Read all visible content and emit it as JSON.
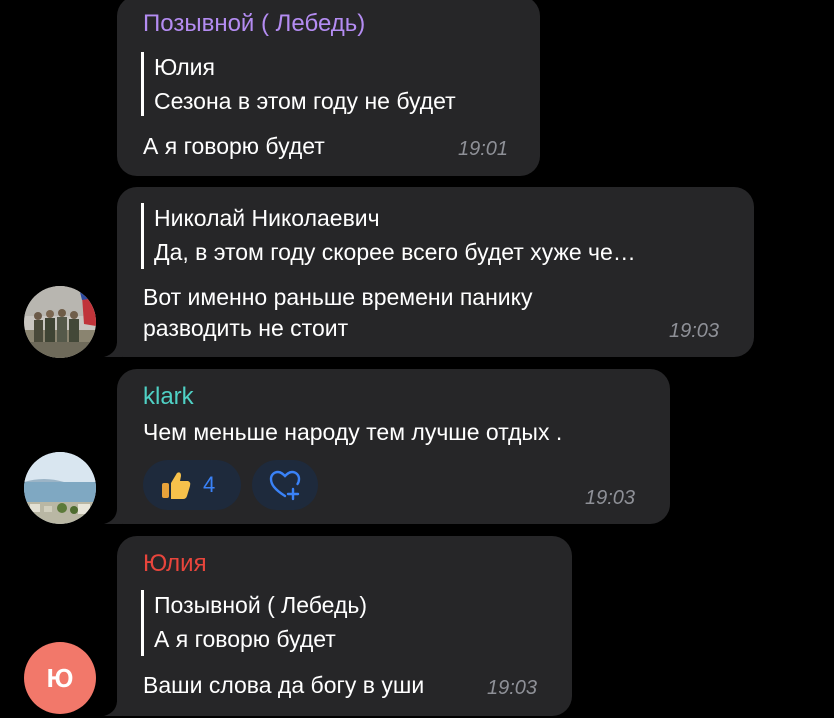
{
  "colors": {
    "background": "#000000",
    "bubble": "#262628",
    "timestamp": "#8e9097",
    "sender_lebed": "#b48cf2",
    "sender_klark": "#4fd1c5",
    "sender_yulia": "#e8453c",
    "reaction_bg": "#1e2a3c",
    "reaction_count": "#3a82f7",
    "avatar_yu_bg": "#f2786a"
  },
  "messages": [
    {
      "sender": "Позывной ( Лебедь)",
      "reply_to": {
        "name": "Юлия",
        "text": "Сезона в этом году не будет"
      },
      "text": "А я говорю будет",
      "time": "19:01"
    },
    {
      "reply_to": {
        "name": "Николай Николаевич",
        "text": "Да, в этом году скорее всего будет хуже че…"
      },
      "text_line1": "Вот именно раньше времени панику",
      "text_line2": "разводить не стоит",
      "time": "19:03",
      "avatar_icon": "soldiers-photo-avatar"
    },
    {
      "sender": "klark",
      "text": "Чем меньше народу тем лучше отдых .",
      "reactions": [
        {
          "icon": "thumbs-up-icon",
          "count": "4"
        },
        {
          "icon": "heart-plus-icon",
          "count": ""
        }
      ],
      "time": "19:03",
      "avatar_icon": "seaside-photo-avatar"
    },
    {
      "sender": "Юлия",
      "reply_to": {
        "name": "Позывной ( Лебедь)",
        "text": "А я говорю будет"
      },
      "text": "Ваши слова да богу в уши",
      "time": "19:03",
      "avatar_initials": "Ю"
    }
  ]
}
